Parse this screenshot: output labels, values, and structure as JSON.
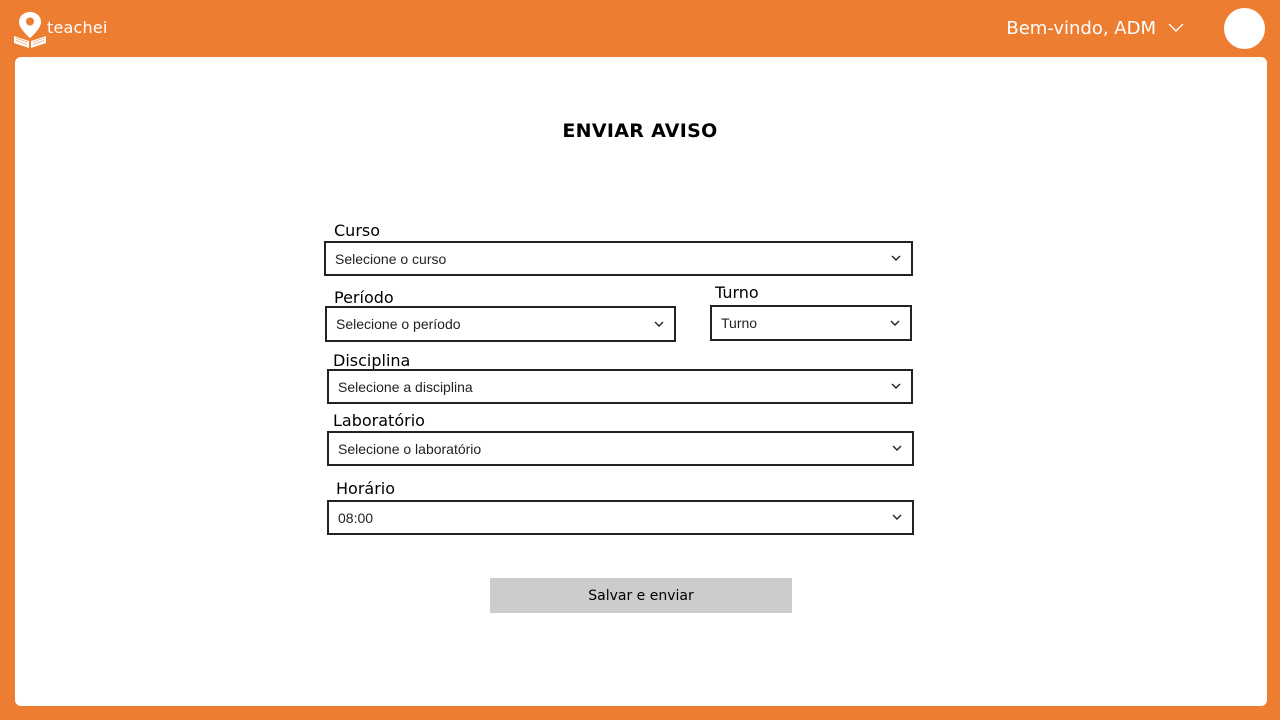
{
  "header": {
    "logo_text": "teachei",
    "welcome": "Bem-vindo, ADM"
  },
  "page": {
    "title": "ENVIAR AVISO"
  },
  "form": {
    "curso": {
      "label": "Curso",
      "value": "Selecione o curso"
    },
    "periodo": {
      "label": "Período",
      "value": "Selecione o período"
    },
    "turno": {
      "label": "Turno",
      "value": "Turno"
    },
    "disciplina": {
      "label": "Disciplina",
      "value": "Selecione a disciplina"
    },
    "laboratorio": {
      "label": "Laboratório",
      "value": "Selecione o laboratório"
    },
    "horario": {
      "label": "Horário",
      "value": "08:00"
    },
    "submit_label": "Salvar e enviar"
  },
  "colors": {
    "brand": "#ED7D31",
    "card": "#FFFFFF",
    "button": "#CCCCCC"
  },
  "icons": [
    "map-pin-book-logo-icon",
    "chevron-down-icon"
  ]
}
